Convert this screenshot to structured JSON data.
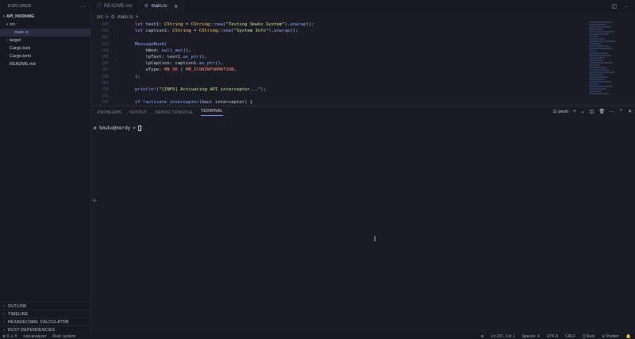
{
  "sidebar": {
    "title": "EXPLORER",
    "project": "API_HOOKING",
    "tree": [
      {
        "label": "src",
        "indent": 1,
        "chevron": "v"
      },
      {
        "label": "main.rs",
        "indent": 2,
        "selected": true
      },
      {
        "label": "target",
        "indent": 1,
        "chevron": ">"
      },
      {
        "label": "Cargo.lock",
        "indent": 1
      },
      {
        "label": "Cargo.toml",
        "indent": 1
      },
      {
        "label": "README.md",
        "indent": 1
      }
    ],
    "sections": [
      "OUTLINE",
      "TIMELINE",
      "HEXADECIMAL CALCULATOR",
      "RUST DEPENDENCIES"
    ]
  },
  "tabs": [
    {
      "label": "README.md",
      "icon": "markdown-icon",
      "active": false
    },
    {
      "label": "main.rs",
      "icon": "rust-file-icon",
      "active": true
    }
  ],
  "breadcrumb": [
    "src",
    ">",
    "main.rs",
    ">"
  ],
  "editor": {
    "lines": [
      {
        "num": "180",
        "html": "        <span class='kw'>let</span> text1: <span class='ty'>CString</span> = <span class='ty'>CString</span>::<span class='fn'>new</span>(<span class='st'>\"Testing Smukx System\"</span>).<span class='fn'>unwrap</span>();"
      },
      {
        "num": "181",
        "html": "        <span class='kw'>let</span> caption1: <span class='ty'>CString</span> = <span class='ty'>CString</span>::<span class='fn'>new</span>(<span class='st'>\"System Info\"</span>).<span class='fn'>unwrap</span>();"
      },
      {
        "num": "182",
        "html": ""
      },
      {
        "num": "183",
        "html": "        <span class='fn'>MessageBoxA</span>("
      },
      {
        "num": "184",
        "html": "            hWnd: <span class='fn'>null_mut</span>(),"
      },
      {
        "num": "185",
        "html": "            lpText: text1.<span class='fn'>as_ptr</span>(),"
      },
      {
        "num": "186",
        "html": "            lpCaption: caption1.<span class='fn'>as_ptr</span>(),"
      },
      {
        "num": "187",
        "html": "            uType: <span class='cn'>MB_OK</span> <span class='pu'>|</span> <span class='cn'>MB_ICONINFORMATION</span>,"
      },
      {
        "num": "188",
        "html": "        );"
      },
      {
        "num": "189",
        "html": ""
      },
      {
        "num": "190",
        "html": "        <span class='fn'>println!</span>(<span class='st'>\"[INFO] Activating API interceptor...\"</span>);"
      },
      {
        "num": "191",
        "html": ""
      },
      {
        "num": "192",
        "html": "        <span class='kw'>if</span> <span class='pu'>!</span><span class='fn'>activate_interceptor</span>(<span class='pu'>&amp;</span><span class='kw'>mut</span> interceptor) {"
      }
    ]
  },
  "panel": {
    "tabs": [
      "PROBLEMS",
      "OUTPUT",
      "DEBUG CONSOLE",
      "TERMINAL"
    ],
    "active_tab": "TERMINAL",
    "shell": "pwsh",
    "prompt": "Smukx@nerdy",
    "prompt_symbol": ">"
  },
  "status": {
    "left": [
      "⊗ 0 ⚠ 0",
      "rust-analyzer",
      "Rust: system"
    ],
    "right": [
      "Ln 237, Col 1",
      "Spaces: 4",
      "UTF-8",
      "CRLF",
      "{} Rust",
      "⊘ Prettier"
    ]
  }
}
